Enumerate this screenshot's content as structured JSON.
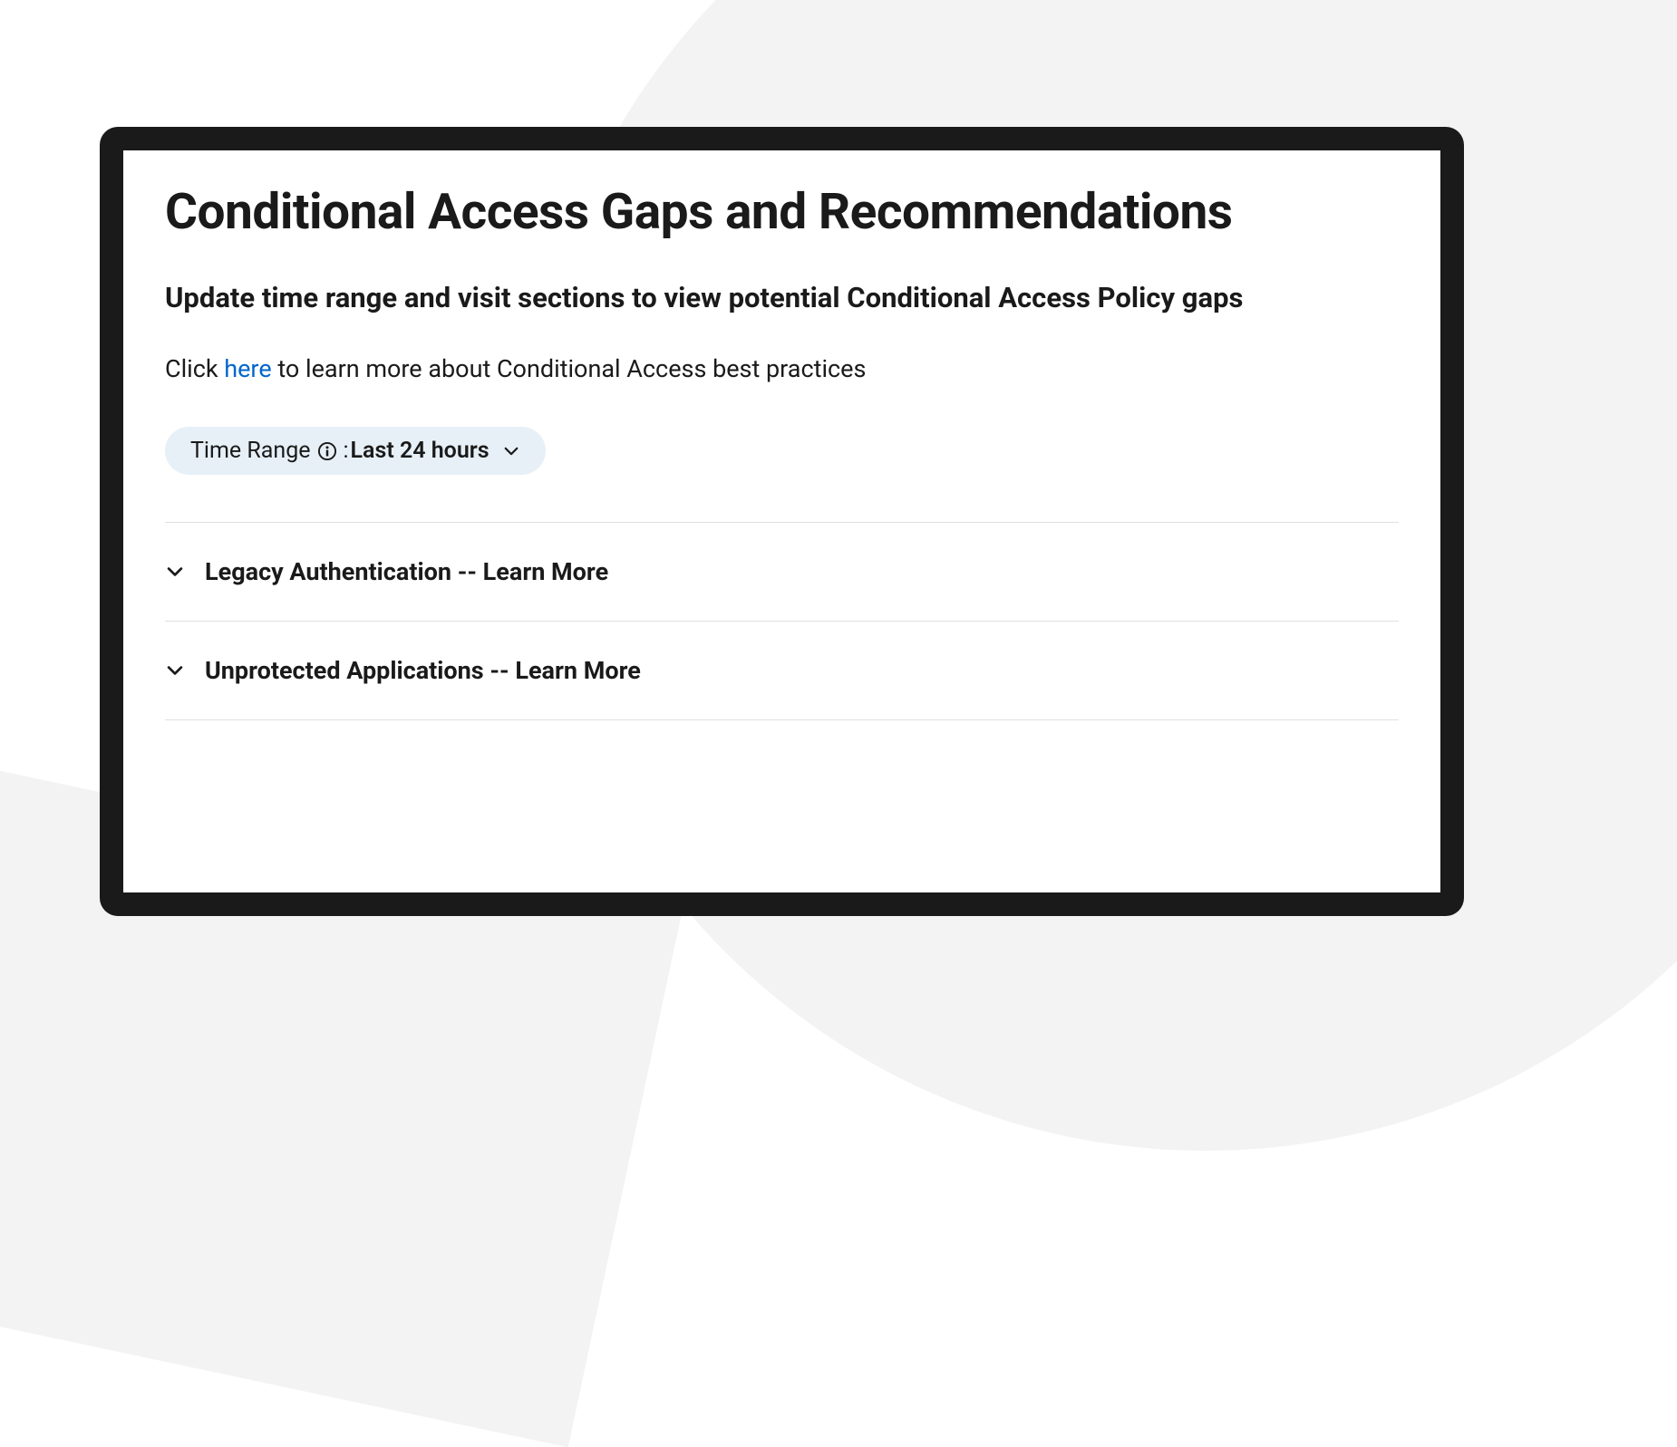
{
  "title": "Conditional Access Gaps and Recommendations",
  "subtitle": "Update time range and visit sections to view potential Conditional Access Policy gaps",
  "description": {
    "prefix": "Click ",
    "link": "here",
    "suffix": " to learn more about Conditional Access best practices"
  },
  "timeRange": {
    "label": "Time Range",
    "separator": ":",
    "value": "Last 24 hours"
  },
  "sections": [
    {
      "title": "Legacy Authentication -- Learn More"
    },
    {
      "title": "Unprotected Applications -- Learn More"
    }
  ]
}
